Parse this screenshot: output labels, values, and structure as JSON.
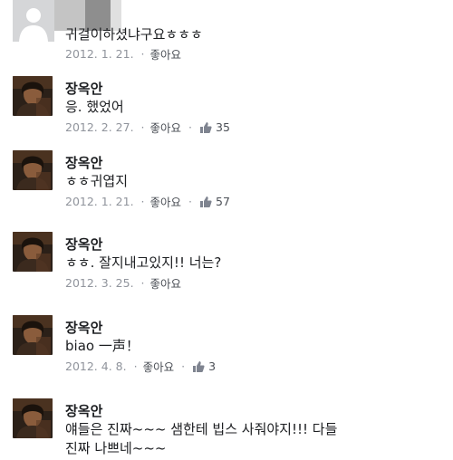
{
  "comments": [
    {
      "name": "",
      "text": "귀걸이하셨냐구요ㅎㅎㅎ",
      "date": "2012. 1. 21.",
      "like_label": "좋아요",
      "like_count": ""
    },
    {
      "name": "장옥안",
      "text": "응. 했었어",
      "date": "2012. 2. 27.",
      "like_label": "좋아요",
      "like_count": "35"
    },
    {
      "name": "장옥안",
      "text": "ㅎㅎ귀엽지",
      "date": "2012. 1. 21.",
      "like_label": "좋아요",
      "like_count": "57"
    },
    {
      "name": "장옥안",
      "text": "ㅎㅎ. 잘지내고있지!! 너는?",
      "date": "2012. 3. 25.",
      "like_label": "좋아요",
      "like_count": ""
    },
    {
      "name": "장옥안",
      "text": "biao 一声！",
      "date": "2012. 4. 8.",
      "like_label": "좋아요",
      "like_count": "3"
    },
    {
      "name": "장옥안",
      "text_line1": "얘들은 진짜~~~ 샘한테 빕스 사줘야지!!! 다들",
      "text_line2": "진짜 나쁘네~~~"
    }
  ],
  "colors": {
    "name": "#1c1e21",
    "meta": "#90949c",
    "like_link": "#4b4f56"
  },
  "icons": {
    "like": "thumbs-up-icon",
    "avatar_default": "default-user-icon",
    "avatar_photo": "profile-photo"
  }
}
